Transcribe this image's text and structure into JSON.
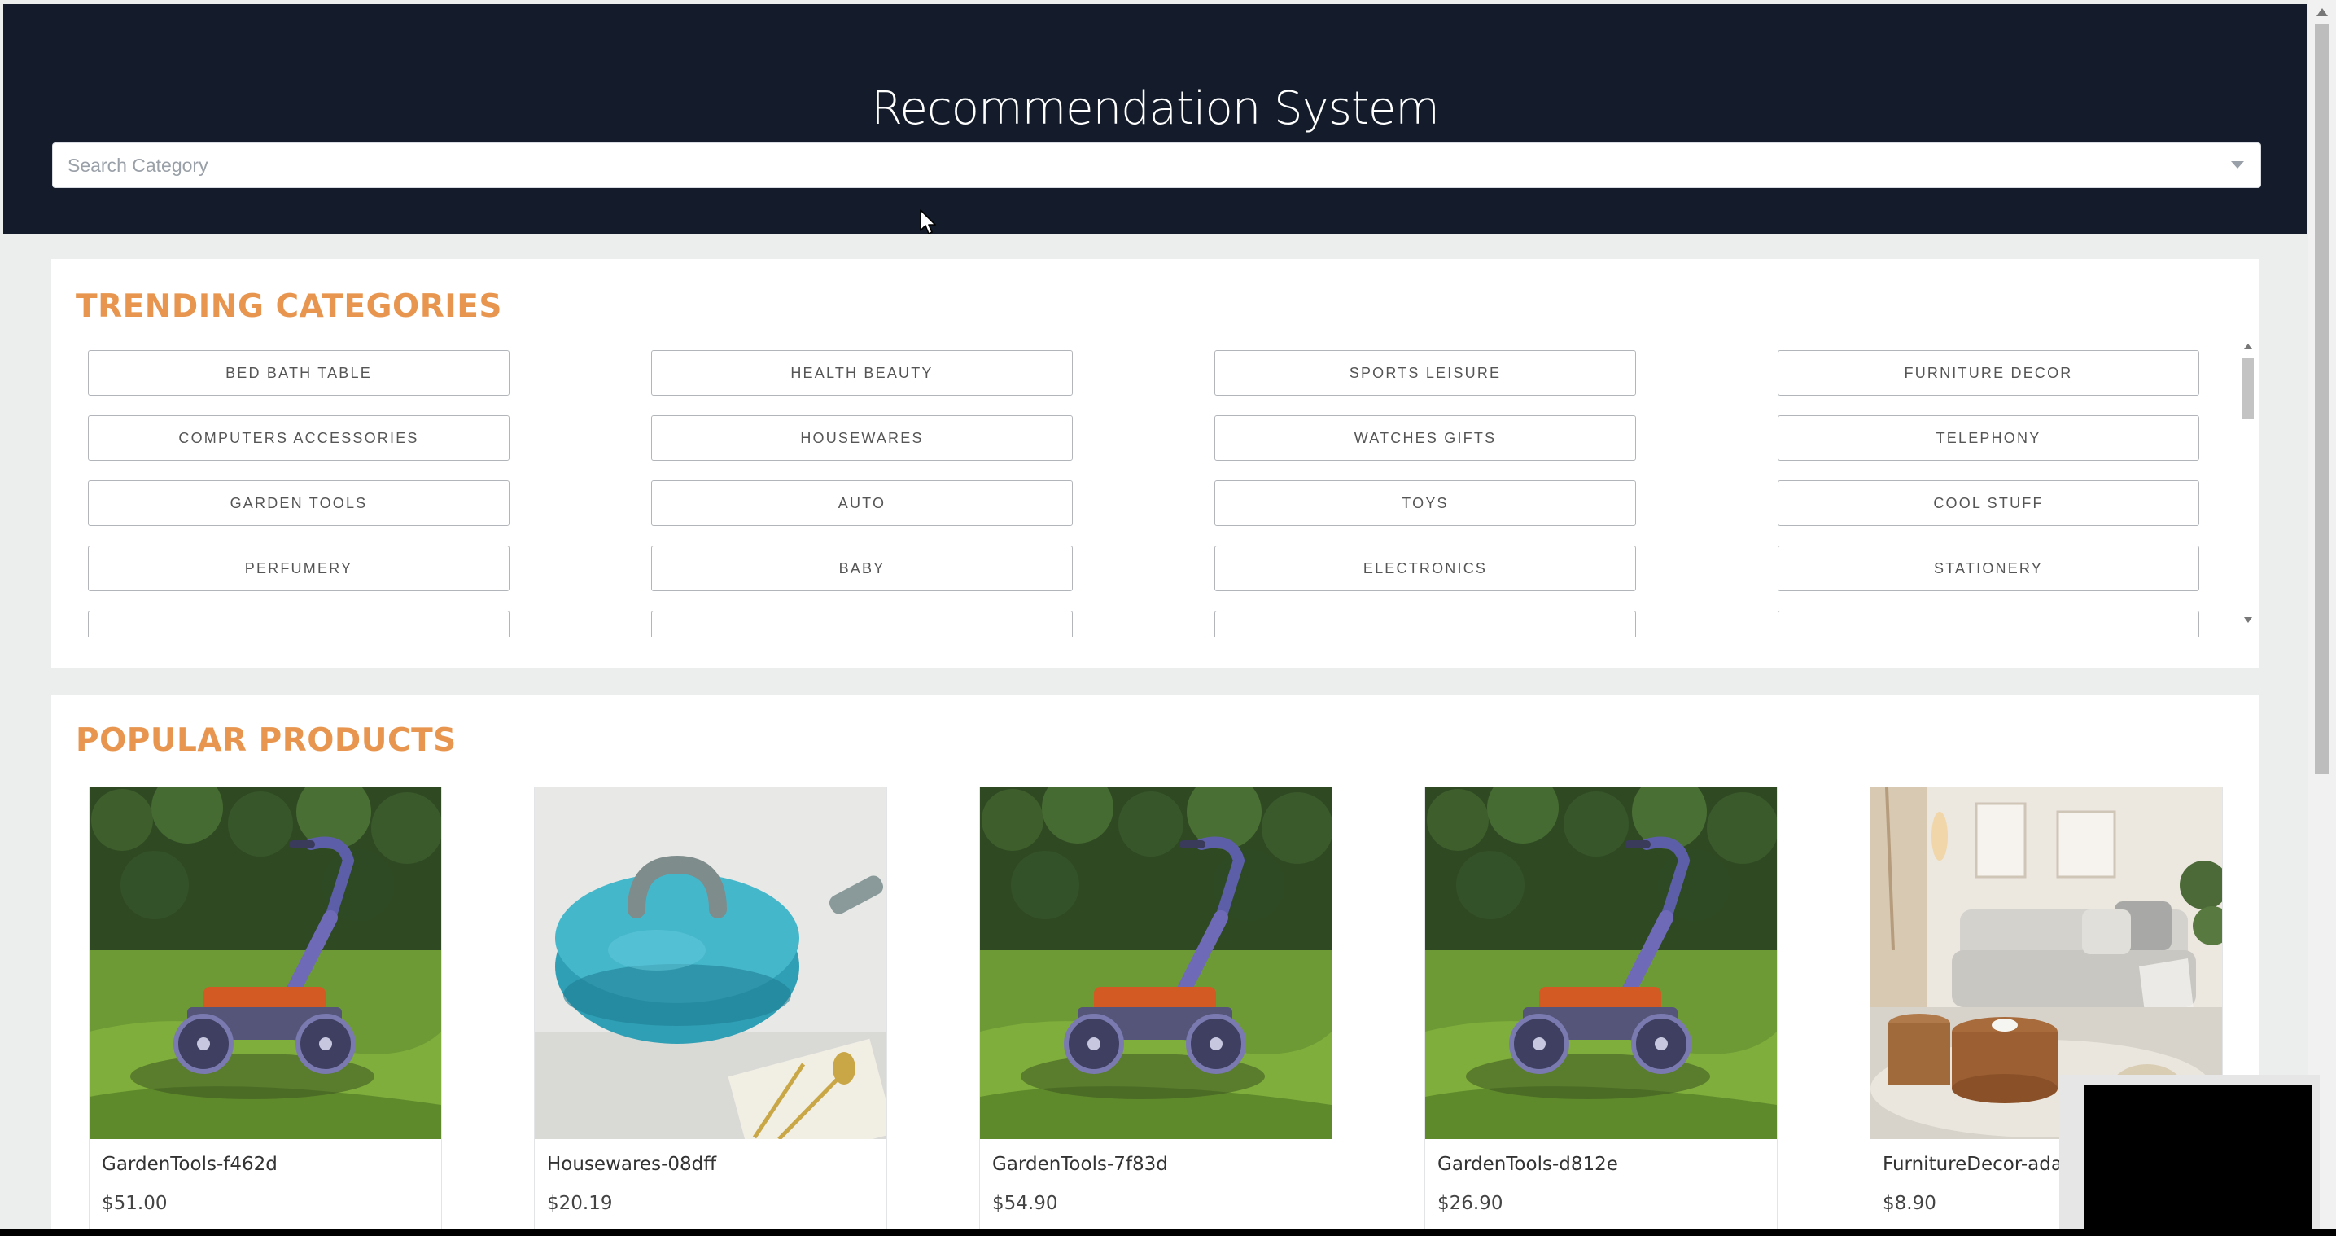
{
  "app": {
    "title": "Recommendation System"
  },
  "search": {
    "placeholder": "Search Category",
    "icon": "chevron-down-icon"
  },
  "trending": {
    "title": "TRENDING CATEGORIES",
    "categories": [
      "BED BATH TABLE",
      "HEALTH BEAUTY",
      "SPORTS LEISURE",
      "FURNITURE DECOR",
      "COMPUTERS ACCESSORIES",
      "HOUSEWARES",
      "WATCHES GIFTS",
      "TELEPHONY",
      "GARDEN TOOLS",
      "AUTO",
      "TOYS",
      "COOL STUFF",
      "PERFUMERY",
      "BABY",
      "ELECTRONICS",
      "STATIONERY"
    ]
  },
  "popular": {
    "title": "POPULAR PRODUCTS",
    "products": [
      {
        "name": "GardenTools-f462d",
        "price": "$51.00",
        "image": "lawn-mower-image"
      },
      {
        "name": "Housewares-08dff",
        "price": "$20.19",
        "image": "saucepan-image"
      },
      {
        "name": "GardenTools-7f83d",
        "price": "$54.90",
        "image": "lawn-mower-image"
      },
      {
        "name": "GardenTools-d812e",
        "price": "$26.90",
        "image": "lawn-mower-image"
      },
      {
        "name": "FurnitureDecor-adab",
        "price": "$8.90",
        "image": "living-room-image"
      }
    ]
  },
  "colors": {
    "header_bg": "#141c2b",
    "accent": "#e8964f",
    "page_bg": "#eceeee"
  }
}
